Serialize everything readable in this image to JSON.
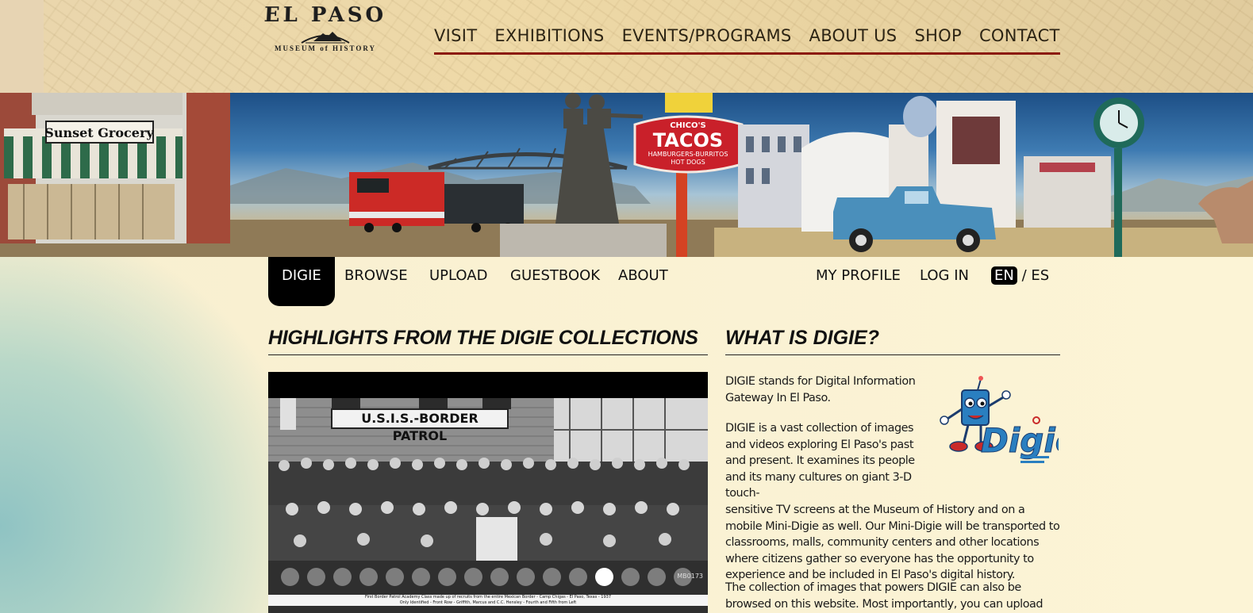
{
  "header": {
    "logo_name": "EL PASO",
    "logo_sub": "MUSEUM of HISTORY",
    "nav": [
      "VISIT",
      "EXHIBITIONS",
      "EVENTS/PROGRAMS",
      "ABOUT US",
      "SHOP",
      "CONTACT"
    ]
  },
  "banner": {
    "grocery_sign": "Sunset Grocery",
    "tacos_sign_top": "CHICO'S",
    "tacos_sign_main": "TACOS",
    "tacos_sign_sub1": "HAMBURGERS-BURRITOS",
    "tacos_sign_sub2": "HOT DOGS"
  },
  "subnav": {
    "digie": "DIGIE",
    "browse": "BROWSE",
    "upload": "UPLOAD",
    "guestbook": "GUESTBOOK",
    "about": "ABOUT",
    "my_profile": "MY PROFILE",
    "log_in": "LOG IN",
    "lang_en": "EN",
    "lang_sep": "/",
    "lang_es": "ES"
  },
  "highlights": {
    "heading": "HIGHLIGHTS FROM THE DIGIE COLLECTIONS",
    "slide_sign": "U.S.I.S.-BORDER PATROL",
    "slide_caption": "First Border Patrol Academy Class made up of recruits from the entire Mexican Border - Camp Chigas - El Paso, Texas - 1937",
    "slide_caption2": "Only Identified - Front Row - Griffith, Marcus and C.C. Hensley - Fourth and Fifth from Left",
    "watermark": "MB0173",
    "dot_count": 16,
    "active_dot": 12
  },
  "what": {
    "heading": "WHAT IS DIGIE?",
    "logo_text": "Digie",
    "para1": "DIGIE stands for Digital Information Gateway In El Paso.",
    "para2_a": "DIGIE is a vast collection of images and videos exploring El Paso's past and present. It examines its people and its many cultures on giant 3-D touch-",
    "para2_b": "sensitive TV screens at the Museum of History and on a mobile Mini-Digie as well. Our Mini-Digie will be transported to classrooms, malls, community centers and other locations where citizens gather so everyone has the opportunity to experience and be included in El Paso's digital history.",
    "para3": "The collection of images that powers DIGIE can also be browsed on this website. Most importantly, you can upload your own"
  },
  "colors": {
    "nav_underline": "#8b1a0e",
    "digie_blue": "#2a7fc0",
    "header_bg": "#eed9a7",
    "page_bg": "#fcf4d6"
  }
}
